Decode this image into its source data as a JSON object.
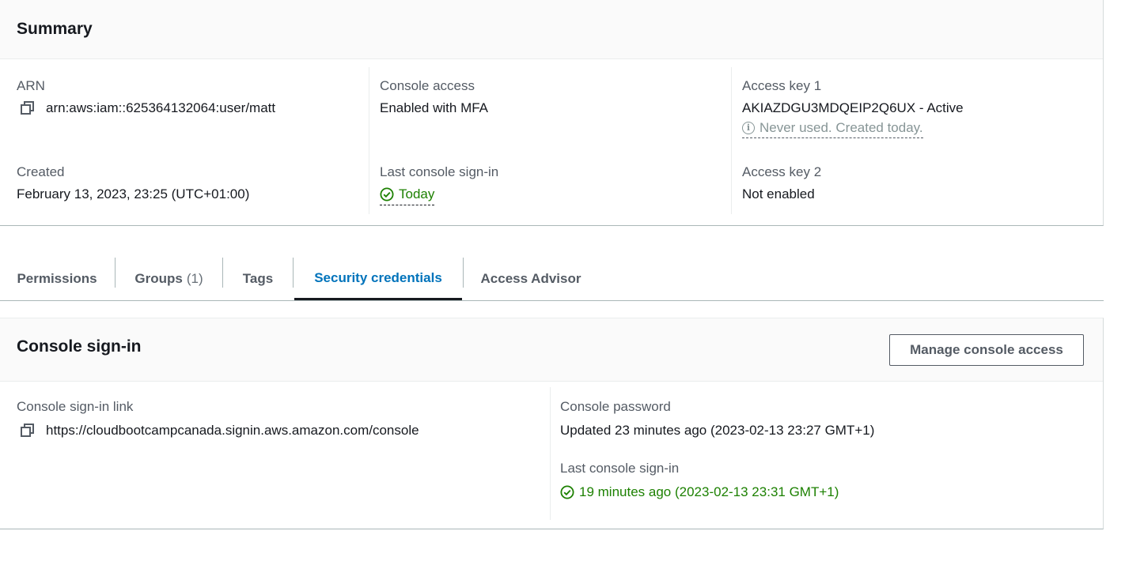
{
  "summary": {
    "title": "Summary",
    "arn": {
      "label": "ARN",
      "value": "arn:aws:iam::625364132064:user/matt"
    },
    "created": {
      "label": "Created",
      "value": "February 13, 2023, 23:25 (UTC+01:00)"
    },
    "console_access": {
      "label": "Console access",
      "value": "Enabled with MFA"
    },
    "last_console_signin": {
      "label": "Last console sign-in",
      "value": "Today"
    },
    "access_key_1": {
      "label": "Access key 1",
      "value": "AKIAZDGU3MDQEIP2Q6UX - Active",
      "note": "Never used. Created today."
    },
    "access_key_2": {
      "label": "Access key 2",
      "value": "Not enabled"
    }
  },
  "tabs": [
    {
      "label": "Permissions",
      "count": ""
    },
    {
      "label": "Groups",
      "count": "(1)"
    },
    {
      "label": "Tags",
      "count": ""
    },
    {
      "label": "Security credentials",
      "count": "",
      "active": true
    },
    {
      "label": "Access Advisor",
      "count": ""
    }
  ],
  "console_signin": {
    "title": "Console sign-in",
    "manage_button": "Manage console access",
    "link": {
      "label": "Console sign-in link",
      "value": "https://cloudbootcampcanada.signin.aws.amazon.com/console"
    },
    "password": {
      "label": "Console password",
      "value": "Updated 23 minutes ago (2023-02-13 23:27 GMT+1)"
    },
    "last_signin": {
      "label": "Last console sign-in",
      "value": "19 minutes ago (2023-02-13 23:31 GMT+1)"
    }
  },
  "colors": {
    "link_blue": "#0073bb",
    "success_green": "#1d8102",
    "text": "#16191f",
    "muted": "#545b64"
  },
  "icons": {
    "copy": "copy-icon",
    "info": "info-icon",
    "success": "check-circle-icon"
  }
}
